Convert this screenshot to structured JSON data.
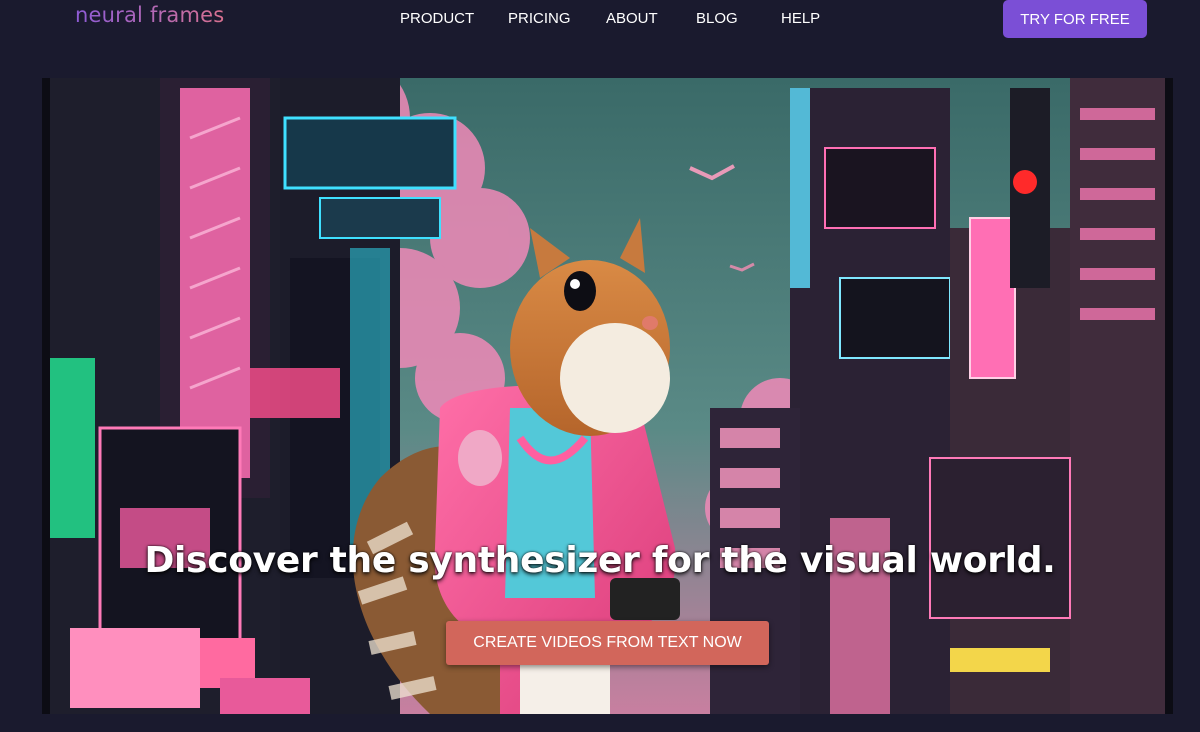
{
  "brand": {
    "logo_text": "neural frames"
  },
  "nav": {
    "links": [
      "PRODUCT",
      "PRICING",
      "ABOUT",
      "BLOG",
      "HELP"
    ],
    "cta_label": "TRY FOR FREE"
  },
  "hero": {
    "headline": "Discover the synthesizer for the visual world.",
    "cta_label": "CREATE VIDEOS FROM TEXT NOW",
    "image_description": "squirrel-in-pink-jacket-neon-city"
  },
  "colors": {
    "page_bg": "#1a1a2e",
    "accent_purple": "#7b4fd6",
    "cta_coral": "#d2665b"
  }
}
